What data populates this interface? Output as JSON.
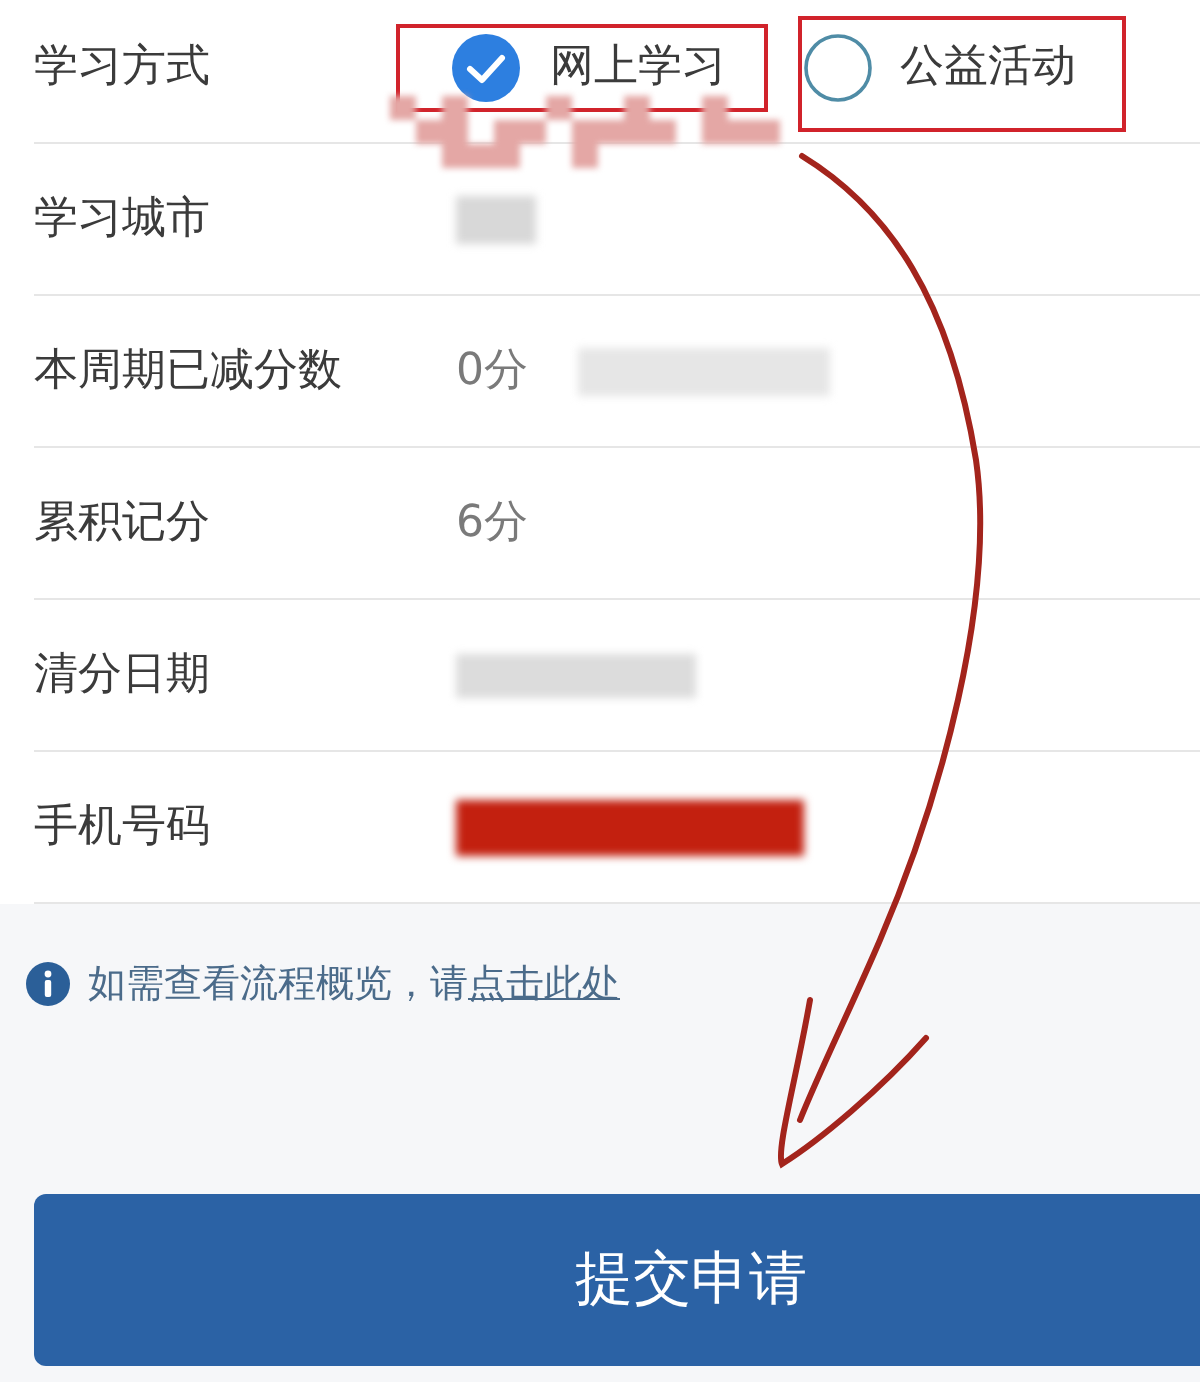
{
  "form": {
    "rows": [
      {
        "kind": "radio",
        "label": "学习方式",
        "options": [
          {
            "label": "网上学习",
            "selected": true,
            "highlighted": true
          },
          {
            "label": "公益活动",
            "selected": false,
            "highlighted": true
          }
        ],
        "redaction": {
          "color": "#e4a7a5"
        }
      },
      {
        "kind": "text",
        "label": "学习城市",
        "redaction": {
          "color": "#d8d8d8"
        }
      },
      {
        "kind": "text",
        "label": "本周期已减分数",
        "value": "0分",
        "redaction": {
          "color": "#e6e6e6"
        }
      },
      {
        "kind": "text",
        "label": "累积记分",
        "value": "6分"
      },
      {
        "kind": "text",
        "label": "清分日期",
        "redaction": {
          "color": "#dcdcdc"
        }
      },
      {
        "kind": "text",
        "label": "手机号码",
        "redaction": {
          "color": "#c3200f"
        }
      }
    ]
  },
  "notice": {
    "text": "如需查看流程概览，请",
    "link": "点击此处"
  },
  "submit_button": {
    "label": "提交申请"
  }
}
